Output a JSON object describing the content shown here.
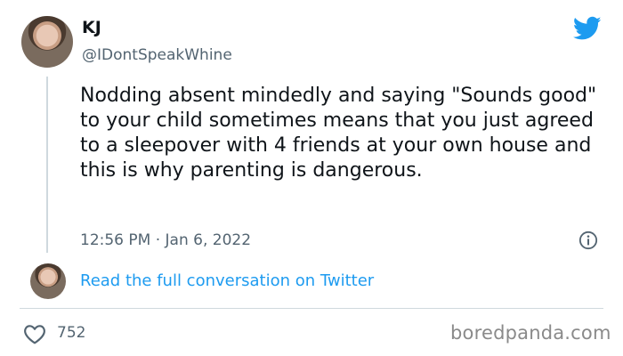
{
  "user": {
    "name": "KJ",
    "handle": "@IDontSpeakWhine"
  },
  "tweet": {
    "text": "Nodding absent mindedly and saying \"Sounds good\" to your child sometimes means that you just agreed to a sleepover with 4 friends at your own house and this is why parenting is dangerous.",
    "timestamp": "12:56 PM · Jan 6, 2022"
  },
  "actions": {
    "read_more": "Read the full conversation on Twitter",
    "likes": "752"
  },
  "watermark": "boredpanda.com",
  "icons": {
    "brand": "twitter-bird-icon",
    "info": "info-icon",
    "like": "heart-icon"
  },
  "colors": {
    "twitter_blue": "#1d9bf0",
    "secondary_text": "#536471",
    "primary_text": "#0f1419",
    "divider": "#cfd9de"
  }
}
